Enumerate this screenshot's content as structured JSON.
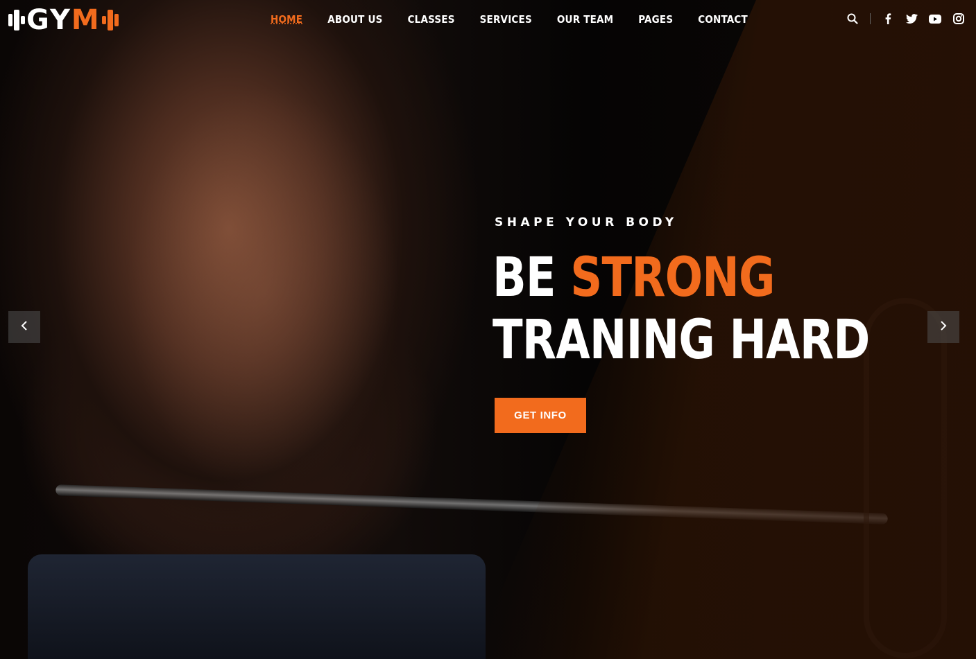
{
  "brand": {
    "logo_left": "GY",
    "logo_right": "M",
    "accent_color": "#f26b1d"
  },
  "nav": {
    "items": [
      {
        "label": "HOME",
        "active": true
      },
      {
        "label": "ABOUT US"
      },
      {
        "label": "CLASSES"
      },
      {
        "label": "SERVICES"
      },
      {
        "label": "OUR TEAM"
      },
      {
        "label": "PAGES"
      },
      {
        "label": "CONTACT"
      }
    ]
  },
  "tools": {
    "icons": [
      "search-icon",
      "facebook-icon",
      "twitter-icon",
      "youtube-icon",
      "instagram-icon"
    ]
  },
  "hero": {
    "kicker": "SHAPE YOUR BODY",
    "headline_line1_a": "BE ",
    "headline_line1_b": "STRONG",
    "headline_line2": "TRANING HARD",
    "cta_label": "GET INFO"
  },
  "slider": {
    "prev_icon": "chevron-left-icon",
    "next_icon": "chevron-right-icon"
  }
}
